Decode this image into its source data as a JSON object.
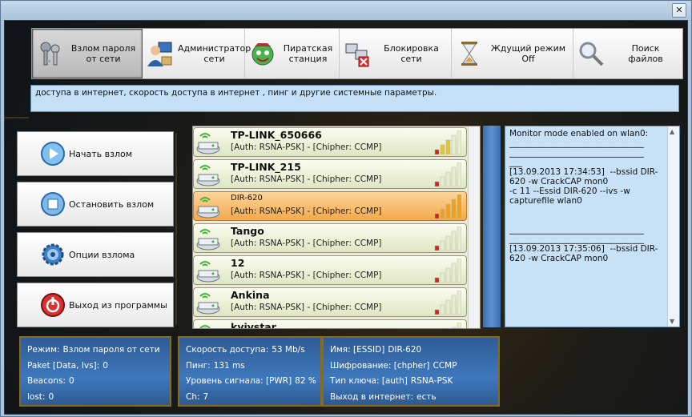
{
  "window": {
    "close_glyph": "✕"
  },
  "toolbar": {
    "buttons": [
      {
        "label": "Взлом пароля от сети",
        "icon": "keys-icon",
        "active": true
      },
      {
        "label": "Администратор сети",
        "icon": "admin-user-icon",
        "active": false
      },
      {
        "label": "Пиратская станция",
        "icon": "pirate-globe-icon",
        "active": false
      },
      {
        "label": "Блокировка сети",
        "icon": "network-block-icon",
        "active": false
      },
      {
        "label": "Ждущий режим Off",
        "icon": "hourglass-icon",
        "active": false
      },
      {
        "label": "Поиск файлов",
        "icon": "magnifier-icon",
        "active": false
      }
    ]
  },
  "info_bar": {
    "text": "доступа в интернет, скорость доступа в интернет , пинг и другие системные параметры."
  },
  "side_buttons": [
    {
      "label": "Начать взлом",
      "icon": "play-icon"
    },
    {
      "label": "Остановить взлом",
      "icon": "stop-icon"
    },
    {
      "label": "Опции взлома",
      "icon": "gear-icon"
    },
    {
      "label": "Выход из программы",
      "icon": "power-icon"
    }
  ],
  "networks": [
    {
      "name": "TP-LINK_650666",
      "auth": "[Auth: RSNA-PSK] - [Chipher: CCMP]",
      "signal": 3,
      "selected": false
    },
    {
      "name": "TP-LINK_215",
      "auth": "[Auth: RSNA-PSK] - [Chipher: CCMP]",
      "signal": 1,
      "selected": false
    },
    {
      "name": "DIR-620",
      "auth": "[Auth: RSNA-PSK] - [Chipher: CCMP]",
      "signal": 5,
      "selected": true
    },
    {
      "name": "Tango",
      "auth": "[Auth: RSNA-PSK] - [Chipher: CCMP]",
      "signal": 1,
      "selected": false
    },
    {
      "name": "12",
      "auth": "[Auth: RSNA-PSK] - [Chipher: CCMP]",
      "signal": 1,
      "selected": false
    },
    {
      "name": "Ankina",
      "auth": "[Auth: RSNA-PSK] - [Chipher: CCMP]",
      "signal": 1,
      "selected": false
    },
    {
      "name": "kyivstar",
      "auth": "",
      "signal": 1,
      "selected": false
    }
  ],
  "log": {
    "lines": [
      "Monitor mode enabled on wlan0:",
      "________________________________",
      "________________________________",
      "___",
      "[13.09.2013 17:34:53]  --bssid DIR-620 -w CrackCAP mon0",
      "-c 11 --Essid DIR-620 --ivs -w capturefile wlan0",
      "",
      "________________________________",
      "________________________________",
      "[13.09.2013 17:35:06]  --bssid DIR-620 -w CrackCAP mon0"
    ]
  },
  "status": {
    "box1": [
      {
        "label": "Режим:",
        "value": "Взлом пароля от сети"
      },
      {
        "label": "Paket [Data, Ivs]:",
        "value": "0"
      },
      {
        "label": "Beacons:",
        "value": "0"
      },
      {
        "label": "lost:",
        "value": "0"
      }
    ],
    "box2": [
      {
        "label": "Скорость доступа:",
        "value": "53 Mb/s"
      },
      {
        "label": "Пинг:",
        "value": "131 ms"
      },
      {
        "label": "Уровень сигнала: [PWR]",
        "value": "82 %"
      },
      {
        "label": "Ch:",
        "value": "7"
      }
    ],
    "box3": [
      {
        "label": "Имя: [ESSID]",
        "value": "DIR-620"
      },
      {
        "label": "Шифрование: [chpher]",
        "value": "CCMP"
      },
      {
        "label": "Тип ключа: [auth]",
        "value": "RSNA-PSK"
      },
      {
        "label": "Выход в интернет:",
        "value": "есть"
      }
    ]
  }
}
